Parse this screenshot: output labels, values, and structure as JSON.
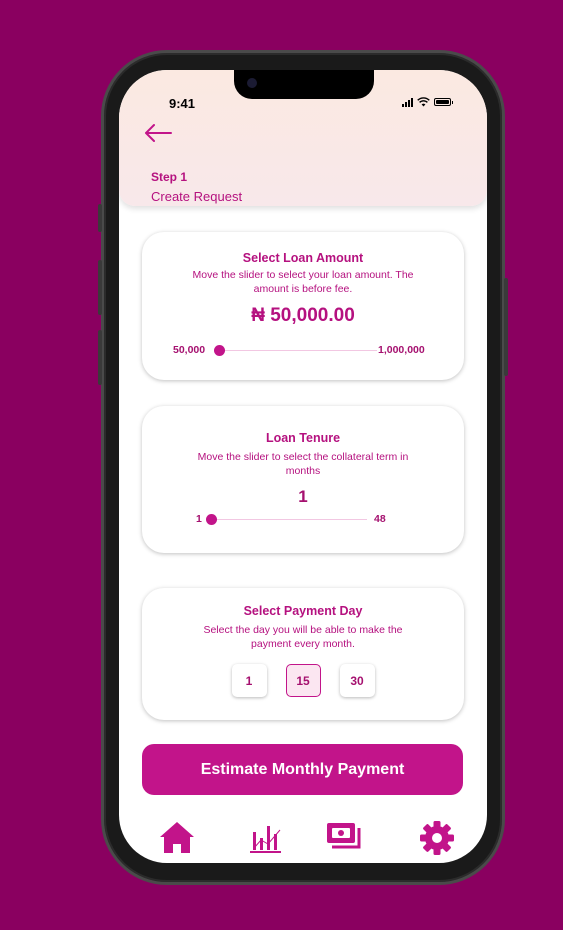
{
  "status_bar": {
    "time": "9:41"
  },
  "header": {
    "step_label": "Step 1",
    "step_title": "Create Request"
  },
  "loan_amount": {
    "title": "Select Loan Amount",
    "description": "Move the slider to select your loan amount. The amount is before fee.",
    "value": "₦ 50,000.00",
    "min_label": "50,000",
    "max_label": "1,000,000",
    "slider_value_fraction": 0.0
  },
  "tenure": {
    "title": "Loan Tenure",
    "description": "Move the slider to select the collateral term in months",
    "value": "1",
    "min_label": "1",
    "max_label": "48",
    "slider_value_fraction": 0.0
  },
  "payment_day": {
    "title": "Select Payment Day",
    "description": "Select the day you will be able to make the payment every month.",
    "options": [
      "1",
      "15",
      "30"
    ],
    "selected": "15"
  },
  "cta": {
    "label": "Estimate Monthly Payment"
  },
  "tabbar": {
    "icons": [
      "home-icon",
      "analytics-icon",
      "cash-icon",
      "settings-icon"
    ]
  },
  "colors": {
    "background": "#8a0060",
    "accent": "#c2148a",
    "text_accent": "#b5117f",
    "header_bg": "#fbe9e1"
  }
}
